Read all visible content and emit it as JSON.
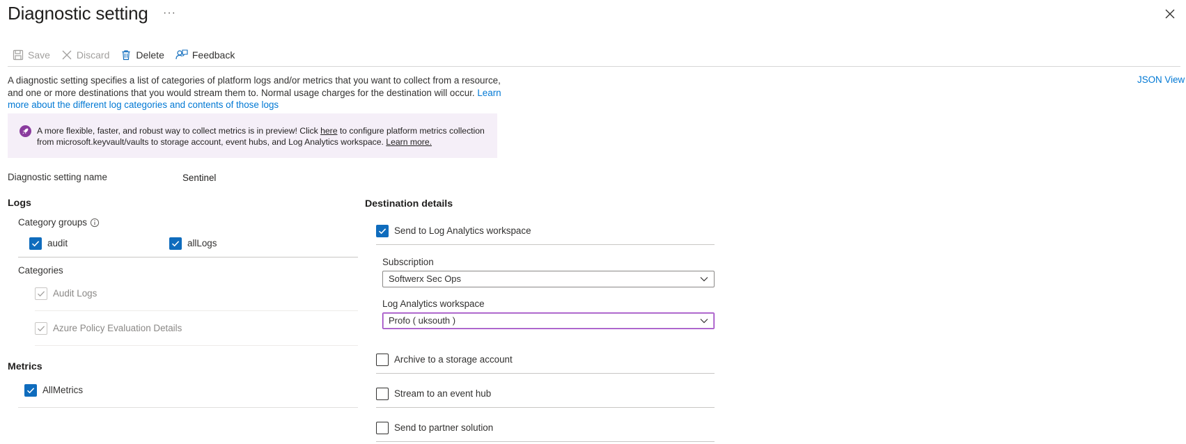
{
  "header": {
    "title": "Diagnostic setting",
    "more_label": "···"
  },
  "toolbar": {
    "save_label": "Save",
    "discard_label": "Discard",
    "delete_label": "Delete",
    "feedback_label": "Feedback"
  },
  "description": {
    "text": "A diagnostic setting specifies a list of categories of platform logs and/or metrics that you want to collect from a resource, and one or more destinations that you would stream them to. Normal usage charges for the destination will occur. ",
    "link": "Learn more about the different log categories and contents of those logs"
  },
  "json_view_label": "JSON View",
  "banner": {
    "text_before": "A more flexible, faster, and robust way to collect metrics is in preview! Click ",
    "here": "here",
    "text_after": " to configure platform metrics collection from microsoft.keyvault/vaults to storage account, event hubs, and Log Analytics workspace. ",
    "learn_more": "Learn more."
  },
  "setting_name": {
    "label": "Diagnostic setting name",
    "value": "Sentinel"
  },
  "logs": {
    "title": "Logs",
    "category_groups_label": "Category groups",
    "groups": [
      {
        "label": "audit",
        "checked": true
      },
      {
        "label": "allLogs",
        "checked": true
      }
    ],
    "categories_label": "Categories",
    "categories": [
      {
        "label": "Audit Logs",
        "checked": true,
        "disabled": true
      },
      {
        "label": "Azure Policy Evaluation Details",
        "checked": true,
        "disabled": true
      }
    ]
  },
  "metrics": {
    "title": "Metrics",
    "items": [
      {
        "label": "AllMetrics",
        "checked": true
      }
    ]
  },
  "destination": {
    "title": "Destination details",
    "log_analytics": {
      "label": "Send to Log Analytics workspace",
      "checked": true,
      "subscription_label": "Subscription",
      "subscription_value": "Softwerx Sec Ops",
      "workspace_label": "Log Analytics workspace",
      "workspace_value": "Profo ( uksouth )"
    },
    "storage_label": "Archive to a storage account",
    "eventhub_label": "Stream to an event hub",
    "partner_label": "Send to partner solution"
  },
  "colors": {
    "accent": "#0f6cbd",
    "link": "#0078d4",
    "banner_bg": "#f5eff8",
    "banner_icon": "#8a3b9e",
    "focus_border": "#9a37c4"
  }
}
